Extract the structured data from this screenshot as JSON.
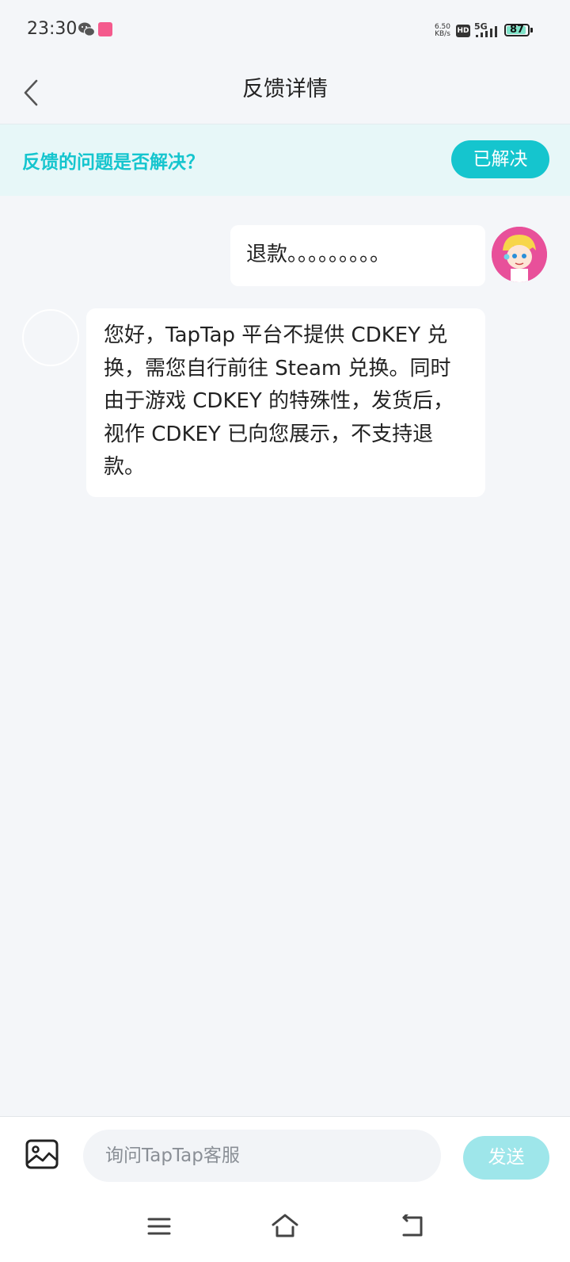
{
  "status_bar": {
    "time": "23:30",
    "net_speed_value": "6.50",
    "net_speed_unit": "KB/s",
    "hd_label": "HD",
    "network_label": "5G",
    "battery_level": "87",
    "icons": [
      "wechat-icon",
      "app-notification-icon",
      "signal-icon",
      "battery-icon"
    ]
  },
  "header": {
    "title": "反馈详情",
    "back_icon": "chevron-left-icon"
  },
  "resolve_banner": {
    "question": "反馈的问题是否解决？",
    "resolved_label": "已解决"
  },
  "conversation": {
    "user_message": "退款。。。。。。。。。",
    "support_message": "您好，TapTap 平台不提供 CDKEY 兑换，需您自行前往 Steam 兑换。同时由于游戏 CDKEY 的特殊性，发货后，视作 CDKEY 已向您展示，不支持退款。"
  },
  "composer": {
    "image_icon": "image-icon",
    "placeholder": "询问TapTap客服",
    "value": "",
    "send_label": "发送"
  },
  "system_nav": {
    "icons": [
      "menu-icon",
      "home-icon",
      "back-icon"
    ]
  },
  "colors": {
    "accent": "#15c5ce",
    "send_disabled": "#9ee6ea",
    "background": "#f4f6f9",
    "banner_background": "#e7f7f8"
  }
}
